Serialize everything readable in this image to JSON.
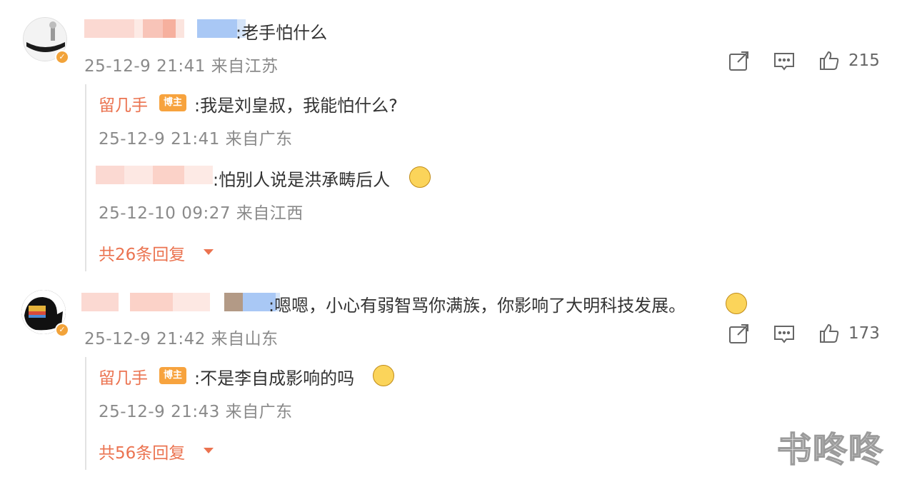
{
  "comments": [
    {
      "text": ":老手怕什么",
      "meta": "25-12-9 21:41 来自江苏",
      "like_count": "215",
      "replies": [
        {
          "author": "留几手",
          "badge": "博主",
          "text": ":我是刘皇叔，我能怕什么?",
          "meta": "25-12-9 21:41 来自广东"
        },
        {
          "author": "",
          "text": ":怕别人说是洪承畴后人",
          "meta": "25-12-10 09:27 来自江西"
        }
      ],
      "more_replies": "共26条回复"
    },
    {
      "text": ":嗯嗯，小心有弱智骂你满族，你影响了大明科技发展。",
      "meta": "25-12-9 21:42 来自山东",
      "like_count": "173",
      "replies": [
        {
          "author": "留几手",
          "badge": "博主",
          "text": ":不是李自成影响的吗",
          "meta": "25-12-9 21:43 来自广东"
        }
      ],
      "more_replies": "共56条回复"
    }
  ],
  "icons": [
    "share-icon",
    "comment-icon",
    "like-icon",
    "caret-down-icon",
    "verified-icon"
  ],
  "colors": {
    "author": "#eb7350",
    "badge": "#f7a33e",
    "meta": "#8a8a8a"
  },
  "watermark": "书咚咚"
}
